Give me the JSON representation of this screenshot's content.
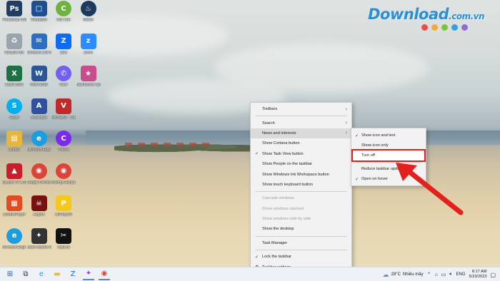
{
  "watermark": {
    "text": "Download",
    "suffix": ".com.vn",
    "dot_colors": [
      "#e94d4d",
      "#f2a93b",
      "#7cc242",
      "#3aa0dc",
      "#8f6bd1"
    ]
  },
  "desktop": {
    "icons": [
      {
        "label": "Photoshop CS6-Portab...",
        "icon": "photoshop-icon",
        "color": "#203d63",
        "glyph": "Ps",
        "col": 0,
        "row": 0
      },
      {
        "label": "VirtualBox",
        "icon": "virtualbox-icon",
        "color": "#1d4f92",
        "glyph": "□",
        "col": 1,
        "row": 0
      },
      {
        "label": "Cốc Cốc",
        "icon": "coccoc-icon",
        "color": "#6cb33f",
        "glyph": "C",
        "col": 2,
        "row": 0,
        "round": true
      },
      {
        "label": "Steam",
        "icon": "steam-icon",
        "color": "#1b3a5c",
        "glyph": "♨",
        "col": 3,
        "row": 0,
        "round": true
      },
      {
        "label": "Recycle Bin",
        "icon": "recycle-bin-icon",
        "color": "#9aa4ad",
        "glyph": "♻",
        "col": 0,
        "row": 1
      },
      {
        "label": "Windows Live Mail",
        "icon": "windows-live-mail-icon",
        "color": "#2d6fbe",
        "glyph": "✉",
        "col": 1,
        "row": 1
      },
      {
        "label": "Zalo",
        "icon": "zalo-icon",
        "color": "#0f6cf2",
        "glyph": "Z",
        "col": 2,
        "row": 1
      },
      {
        "label": "Zoom",
        "icon": "zoom-icon",
        "color": "#2d8cff",
        "glyph": "z",
        "col": 3,
        "row": 1
      },
      {
        "label": "Excel 2016",
        "icon": "excel-icon",
        "color": "#1e7145",
        "glyph": "X",
        "col": 0,
        "row": 2
      },
      {
        "label": "Word 2016",
        "icon": "word-icon",
        "color": "#2b5797",
        "glyph": "W",
        "col": 1,
        "row": 2
      },
      {
        "label": "Viber",
        "icon": "viber-icon",
        "color": "#7360f2",
        "glyph": "✆",
        "col": 2,
        "row": 2,
        "round": true
      },
      {
        "label": "Backrooms Tycoon - Online Mu...",
        "icon": "game-icon",
        "color": "#c74d8c",
        "glyph": "★",
        "col": 3,
        "row": 2
      },
      {
        "label": "Skype",
        "icon": "skype-icon",
        "color": "#00aff0",
        "glyph": "S",
        "col": 0,
        "row": 3,
        "round": true
      },
      {
        "label": "ACalcquel",
        "icon": "acalc-icon",
        "color": "#3050a0",
        "glyph": "A",
        "col": 1,
        "row": 3
      },
      {
        "label": "UniKeyNT - Shortcut",
        "icon": "unikey-icon",
        "color": "#c12a2a",
        "glyph": "V",
        "col": 2,
        "row": 3
      },
      {
        "label": "Library",
        "icon": "folder-icon",
        "color": "#e7b73d",
        "glyph": "▤",
        "col": 0,
        "row": 4
      },
      {
        "label": "Microsoft Edge",
        "icon": "edge-icon",
        "color": "#1b9de2",
        "glyph": "e",
        "col": 1,
        "row": 4,
        "round": true
      },
      {
        "label": "Canva",
        "icon": "canva-icon",
        "color": "#7d2ae8",
        "glyph": "C",
        "col": 2,
        "row": 4,
        "round": true
      },
      {
        "label": "CLuster IV 1.331",
        "icon": "cluster-icon",
        "color": "#c81f2a",
        "glyph": "▲",
        "col": 0,
        "row": 5
      },
      {
        "label": "Google Chrome",
        "icon": "chrome-icon",
        "color": "#db4437",
        "glyph": "◉",
        "col": 1,
        "row": 5,
        "round": true
      },
      {
        "label": "Hướng Giang Chrome",
        "icon": "chrome-profile-icon",
        "color": "#db4437",
        "glyph": "◉",
        "col": 2,
        "row": 5,
        "round": true
      },
      {
        "label": "LDMultiPlayer",
        "icon": "ldmultiplayer-icon",
        "color": "#e34c22",
        "glyph": "▦",
        "col": 0,
        "row": 6
      },
      {
        "label": "Avgent",
        "icon": "avgent-icon",
        "color": "#7a1111",
        "glyph": "☠",
        "col": 1,
        "row": 6
      },
      {
        "label": "LDPlayer9",
        "icon": "ldplayer-icon",
        "color": "#f4c81d",
        "glyph": "P",
        "col": 2,
        "row": 6
      },
      {
        "label": "Microsoft Edge",
        "icon": "edge-icon",
        "color": "#1b9de2",
        "glyph": "e",
        "col": 0,
        "row": 7,
        "round": true
      },
      {
        "label": "Basic Awares Skills",
        "icon": "basic-skills-icon",
        "color": "#333333",
        "glyph": "✦",
        "col": 1,
        "row": 7
      },
      {
        "label": "CapCut",
        "icon": "capcut-icon",
        "color": "#111111",
        "glyph": "✂",
        "col": 2,
        "row": 7
      }
    ]
  },
  "context_menu": {
    "items": [
      {
        "label": "Toolbars",
        "submenu": true
      },
      {
        "sep": true
      },
      {
        "label": "Search",
        "submenu": true
      },
      {
        "label": "News and interests",
        "submenu": true,
        "highlighted": true
      },
      {
        "label": "Show Cortana button"
      },
      {
        "label": "Show Task View button",
        "checked": true
      },
      {
        "label": "Show People on the taskbar"
      },
      {
        "label": "Show Windows Ink Workspace button"
      },
      {
        "label": "Show touch keyboard button"
      },
      {
        "sep": true
      },
      {
        "label": "Cascade windows",
        "disabled": true
      },
      {
        "label": "Show windows stacked",
        "disabled": true
      },
      {
        "label": "Show windows side by side",
        "disabled": true
      },
      {
        "label": "Show the desktop"
      },
      {
        "sep": true
      },
      {
        "label": "Task Manager"
      },
      {
        "sep": true
      },
      {
        "label": "Lock the taskbar",
        "checked": true
      },
      {
        "label": "Taskbar settings",
        "gear": true
      }
    ]
  },
  "submenu": {
    "items": [
      {
        "label": "Show icon and text",
        "checked": true
      },
      {
        "label": "Show icon only"
      },
      {
        "label": "Turn off",
        "boxed": true
      },
      {
        "sep": true
      },
      {
        "label": "Reduce taskbar updates"
      },
      {
        "label": "Open on hover",
        "checked": true
      }
    ]
  },
  "annotation": {
    "color": "#e3201b"
  },
  "taskbar": {
    "pinned": [
      {
        "icon": "start-icon",
        "glyph": "⊞",
        "color": "#1e5bbf"
      },
      {
        "icon": "task-view-icon",
        "glyph": "⧉",
        "color": "#333333"
      },
      {
        "icon": "edge-icon",
        "glyph": "e",
        "color": "#1b9de2"
      },
      {
        "icon": "file-explorer-icon",
        "glyph": "▬",
        "color": "#e7b73d"
      },
      {
        "icon": "zalo-icon",
        "glyph": "Z",
        "color": "#0f6cf2"
      },
      {
        "icon": "messenger-icon",
        "glyph": "✦",
        "color": "#a33ee8",
        "active": true
      },
      {
        "icon": "chrome-icon",
        "glyph": "◉",
        "color": "#db4437",
        "active": true
      }
    ],
    "weather_temp": "28°C",
    "weather_desc": "Nhiều mây",
    "language": "ENG",
    "time": "8:17 AM",
    "date": "5/23/2023"
  }
}
